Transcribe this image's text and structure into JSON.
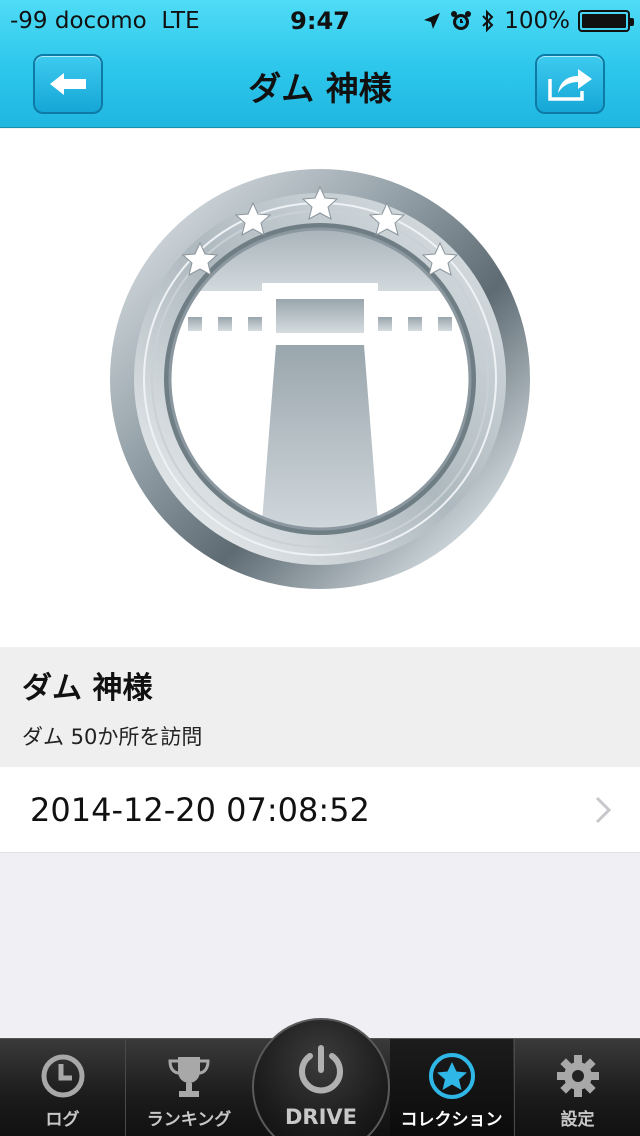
{
  "status": {
    "carrier": "-99 docomo",
    "network": "LTE",
    "time": "9:47",
    "battery": "100%"
  },
  "nav": {
    "title": "ダム 神様",
    "back_icon": "arrow-left-icon",
    "share_icon": "share-arrow-icon"
  },
  "badge": {
    "icon": "dam-badge-icon",
    "stars": 5
  },
  "detail": {
    "name": "ダム 神様",
    "description": "ダム 50か所を訪問"
  },
  "history": {
    "rows": [
      {
        "datetime": "2014-12-20 07:08:52"
      }
    ]
  },
  "tabs": {
    "log": "ログ",
    "ranking": "ランキング",
    "drive": "DRIVE",
    "collection": "コレクション",
    "settings": "設定",
    "active": "collection"
  },
  "colors": {
    "nav_bar": "#2fc8ec",
    "tab_active_icon": "#2fb7e8",
    "tab_bar": "#1b1b1b"
  }
}
